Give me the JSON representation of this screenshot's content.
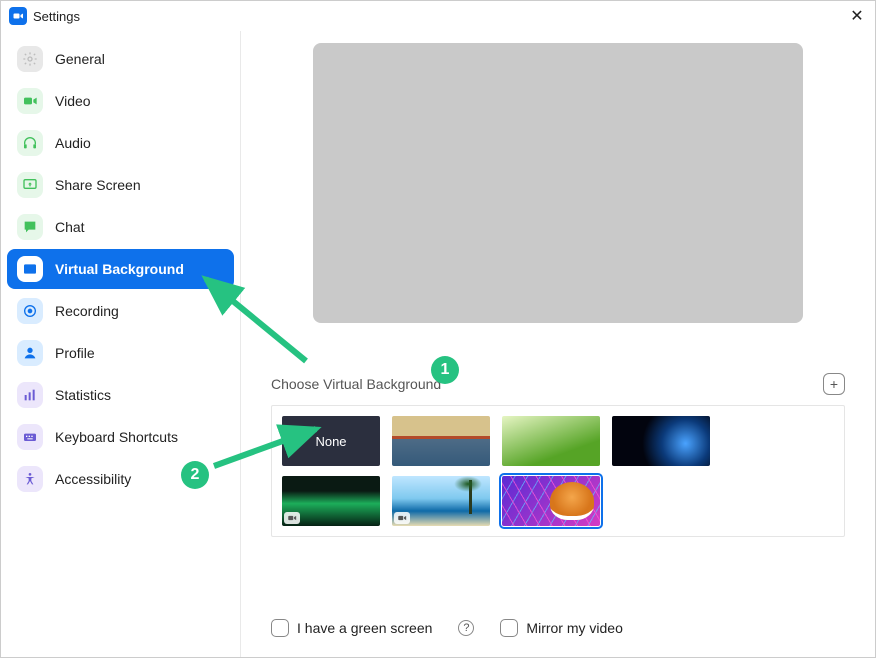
{
  "window": {
    "title": "Settings"
  },
  "sidebar": {
    "items": [
      {
        "label": "General",
        "icon": "gear-icon",
        "bg": "#e8e8e8",
        "fg": "#bdbdbd"
      },
      {
        "label": "Video",
        "icon": "video-icon",
        "bg": "#e6f7e9",
        "fg": "#42c15c"
      },
      {
        "label": "Audio",
        "icon": "headphones-icon",
        "bg": "#e6f7e9",
        "fg": "#42c15c"
      },
      {
        "label": "Share Screen",
        "icon": "share-screen-icon",
        "bg": "#e6f7e9",
        "fg": "#42c15c"
      },
      {
        "label": "Chat",
        "icon": "chat-icon",
        "bg": "#e6f7e9",
        "fg": "#42c15c"
      },
      {
        "label": "Virtual Background",
        "icon": "virtual-background-icon",
        "bg": "#ffffff",
        "fg": "#0E71EB",
        "selected": true
      },
      {
        "label": "Recording",
        "icon": "recording-icon",
        "bg": "#d9ecff",
        "fg": "#0E71EB"
      },
      {
        "label": "Profile",
        "icon": "profile-icon",
        "bg": "#d9ecff",
        "fg": "#0E71EB"
      },
      {
        "label": "Statistics",
        "icon": "statistics-icon",
        "bg": "#ece6fb",
        "fg": "#6b5bd4"
      },
      {
        "label": "Keyboard Shortcuts",
        "icon": "keyboard-icon",
        "bg": "#ece6fb",
        "fg": "#6b5bd4"
      },
      {
        "label": "Accessibility",
        "icon": "accessibility-icon",
        "bg": "#ece6fb",
        "fg": "#6b5bd4"
      }
    ]
  },
  "main": {
    "choose_label": "Choose Virtual Background",
    "add_label": "+",
    "thumbs": {
      "none_label": "None",
      "items": [
        {
          "name": "none",
          "type": "none"
        },
        {
          "name": "golden-gate",
          "type": "image"
        },
        {
          "name": "grass",
          "type": "image"
        },
        {
          "name": "earth-space",
          "type": "image"
        },
        {
          "name": "aurora",
          "type": "video"
        },
        {
          "name": "beach",
          "type": "video"
        },
        {
          "name": "tiger-retro",
          "type": "image",
          "selected": true
        }
      ]
    },
    "green_screen_label": "I have a green screen",
    "mirror_label": "Mirror my video"
  },
  "annotations": {
    "one": "1",
    "two": "2"
  }
}
